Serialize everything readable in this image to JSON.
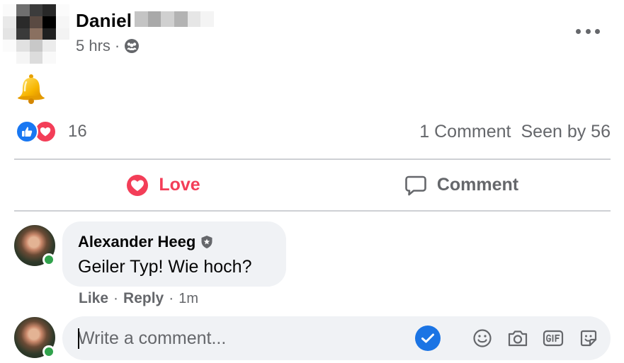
{
  "post": {
    "author_first_name": "Daniel",
    "time": "5 hrs",
    "separator": "·",
    "reaction_count": "16",
    "comments_count": "1 Comment",
    "seen_by": "Seen by 56"
  },
  "actions": {
    "love_label": "Love",
    "comment_label": "Comment"
  },
  "comment": {
    "author": "Alexander Heeg",
    "text": "Geiler Typ! Wie hoch?",
    "like_label": "Like",
    "reply_label": "Reply",
    "separator": "·",
    "time": "1m"
  },
  "composer": {
    "placeholder": "Write a comment..."
  },
  "icons": {
    "audience": "friends-icon",
    "post_emoji": "bell-icon",
    "reactions": [
      "like-reaction-icon",
      "love-reaction-icon"
    ],
    "composer": [
      "check-icon",
      "emoji-icon",
      "camera-icon",
      "gif-icon",
      "sticker-icon"
    ]
  },
  "colors": {
    "love": "#f33e58",
    "like": "#1877f2",
    "secondary_text": "#65676b",
    "bubble": "#f0f2f5",
    "online": "#31a24c"
  }
}
